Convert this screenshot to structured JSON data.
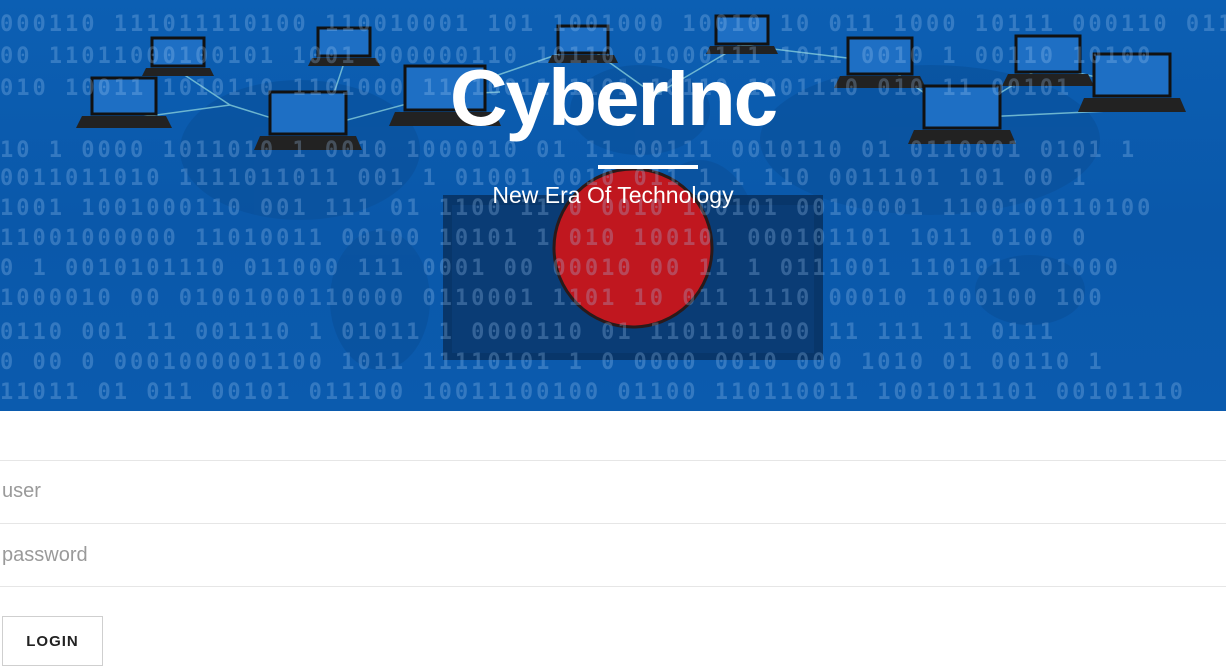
{
  "header": {
    "title": "CyberInc",
    "tagline": "New Era Of Technology"
  },
  "login": {
    "user_placeholder": "user",
    "password_placeholder": "password",
    "button_label": "LOGIN"
  }
}
